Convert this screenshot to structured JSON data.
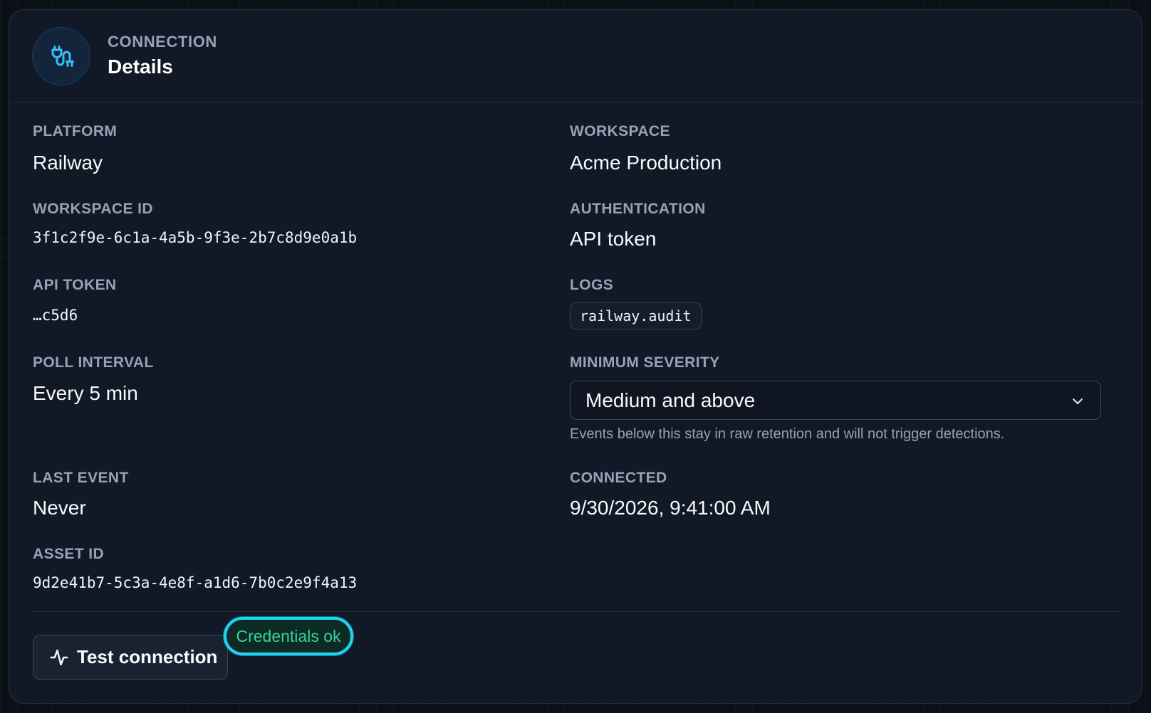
{
  "header": {
    "eyebrow": "CONNECTION",
    "title": "Details",
    "icon": "plug-icon"
  },
  "fields": {
    "platform": {
      "label": "PLATFORM",
      "value": "Railway"
    },
    "workspace": {
      "label": "WORKSPACE",
      "value": "Acme Production"
    },
    "workspace_id": {
      "label": "WORKSPACE ID",
      "value": "3f1c2f9e-6c1a-4a5b-9f3e-2b7c8d9e0a1b"
    },
    "authentication": {
      "label": "AUTHENTICATION",
      "value": "API token"
    },
    "api_token": {
      "label": "API TOKEN",
      "value": "…c5d6"
    },
    "logs": {
      "label": "LOGS",
      "value": "railway.audit"
    },
    "poll_interval": {
      "label": "POLL INTERVAL",
      "value": "Every 5 min"
    },
    "minimum_severity": {
      "label": "MINIMUM SEVERITY",
      "selected": "Medium and above",
      "hint": "Events below this stay in raw retention and will not trigger detections."
    },
    "last_event": {
      "label": "LAST EVENT",
      "value": "Never"
    },
    "connected": {
      "label": "CONNECTED",
      "value": "9/30/2026, 9:41:00 AM"
    },
    "asset_id": {
      "label": "ASSET ID",
      "value": "9d2e41b7-5c3a-4e8f-a1d6-7b0c2e9f4a13"
    }
  },
  "footer": {
    "test_button_label": "Test connection",
    "test_button_icon": "activity-icon",
    "status_text": "Credentials ok"
  },
  "colors": {
    "accent": "#38bdf8",
    "status_ok": "#34d399",
    "focus_ring": "#22d3ee"
  }
}
